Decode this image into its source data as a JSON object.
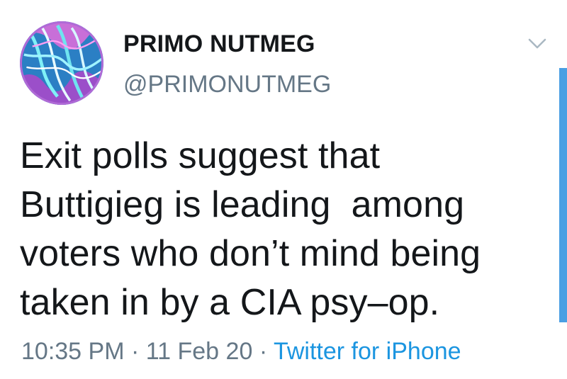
{
  "user": {
    "display_name": "PRIMO NUTMEG",
    "handle": "@PRIMONUTMEG",
    "avatar_icon": "psychedelic-avatar"
  },
  "tweet": {
    "text": "Exit polls suggest that\nButtigieg is leading  among\nvoters who don’t mind being\ntaken in by a CIA psy–op."
  },
  "meta": {
    "time": "10:35 PM",
    "separator": "·",
    "date": "11 Feb 20",
    "source": "Twitter for iPhone"
  },
  "colors": {
    "text": "#14171a",
    "secondary": "#657786",
    "link": "#1b95e0",
    "scrollbar": "#4a9fe3"
  }
}
